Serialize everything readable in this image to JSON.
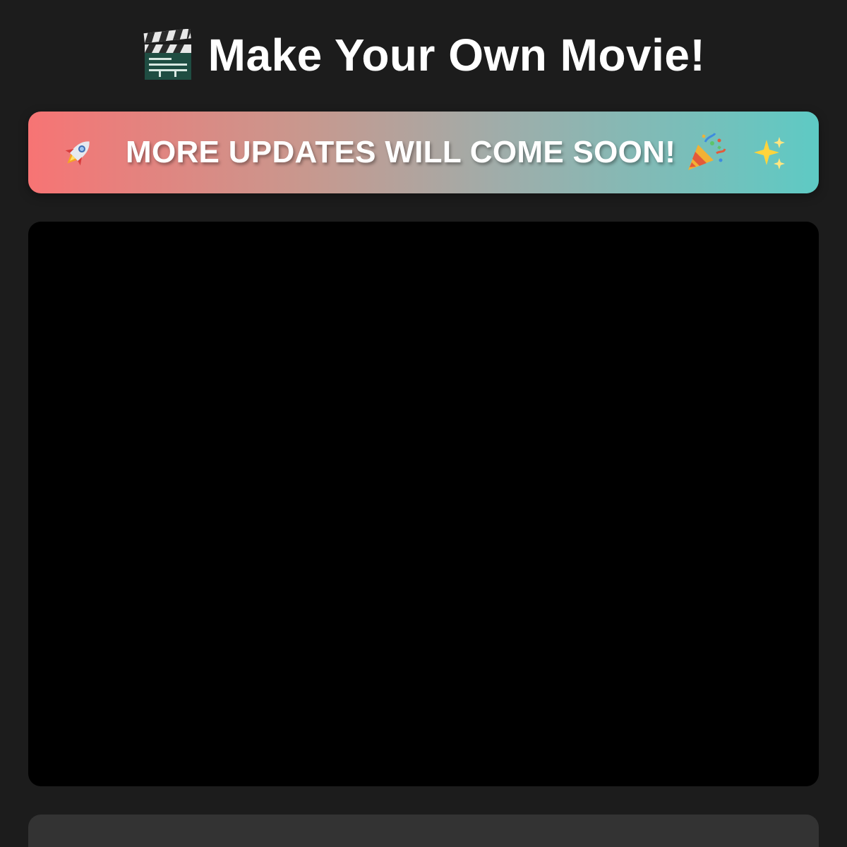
{
  "header": {
    "title": "Make Your Own Movie!",
    "icon": "clapper-board-icon"
  },
  "banner": {
    "text": "MORE UPDATES WILL COME SOON!",
    "left_icon": "rocket-icon",
    "inline_icon": "party-popper-icon",
    "right_icon": "sparkles-icon",
    "gradient_start": "#f77474",
    "gradient_end": "#5ecac4"
  },
  "video": {
    "background": "#000000"
  },
  "colors": {
    "page_background": "#1c1c1c",
    "panel_background": "#333333",
    "text": "#ffffff"
  }
}
